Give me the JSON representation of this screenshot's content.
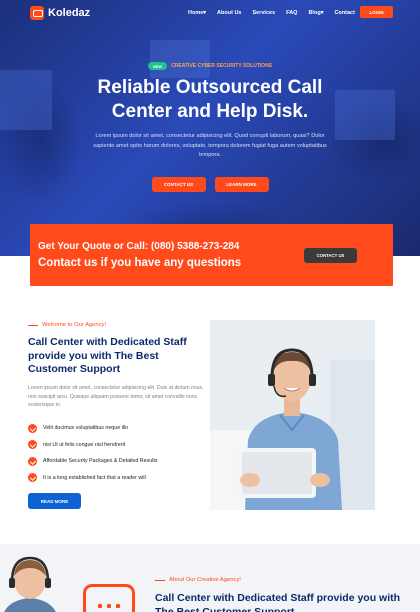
{
  "brand": {
    "name": "Koledaz"
  },
  "nav": {
    "items": [
      {
        "label": "Home",
        "caret": "▾"
      },
      {
        "label": "About Us",
        "caret": ""
      },
      {
        "label": "Services",
        "caret": ""
      },
      {
        "label": "FAQ",
        "caret": ""
      },
      {
        "label": "Blog",
        "caret": "▾"
      },
      {
        "label": "Contact",
        "caret": ""
      }
    ],
    "login_label": "LOGIN"
  },
  "hero": {
    "badge": "NEW",
    "tagline": "CREATIVE CYBER SECURITY SOLUTIONS",
    "title_line1": "Reliable Outsourced Call",
    "title_line2": "Center and Help Disk.",
    "description": "Lorem ipsum dolor sit amet, consectetur adipisicing elit. Quod corrupti laborum, quasi? Dolor sapiente amet optio harum dolores, voluptate, tempora dolorem fugiat fuga autem voluptatibus tempora.",
    "btn_contact": "CONTACT US",
    "btn_learn": "LEARN MORE"
  },
  "quote_bar": {
    "line1": "Get Your Quote or Call: (080) 5388-273-284",
    "line2": "Contact us if you have any questions",
    "button": "CONTACT US"
  },
  "about": {
    "kicker": "Welcome to Our Agency!",
    "title": "Call Center with Dedicated Staff provide you with The Best Customer Support",
    "description": "Lorem ipsum dolor sit amet, consectetur adipisicing elit. Duis at dictum risus, non suscipit arcu. Quisque aliquam posuere tortor, sit amet convallis nunc scelerisque in.",
    "checks": [
      "Velit ducimus voluptatibus neque illo",
      "nisi Ut ut felis congue nisl hendrerit",
      "Affordable Security Packages & Detailed Results",
      "It is a long established fact that a reader will"
    ],
    "read_more": "READ MORE"
  },
  "second": {
    "kicker": "About Our Creative Agency!",
    "title": "Call Center with Dedicated Staff provide you with The Best Customer Support"
  },
  "colors": {
    "accent": "#ff4a1c",
    "navy": "#0d2a6b",
    "blue": "#0d63d4",
    "teal": "#1ec28f"
  }
}
